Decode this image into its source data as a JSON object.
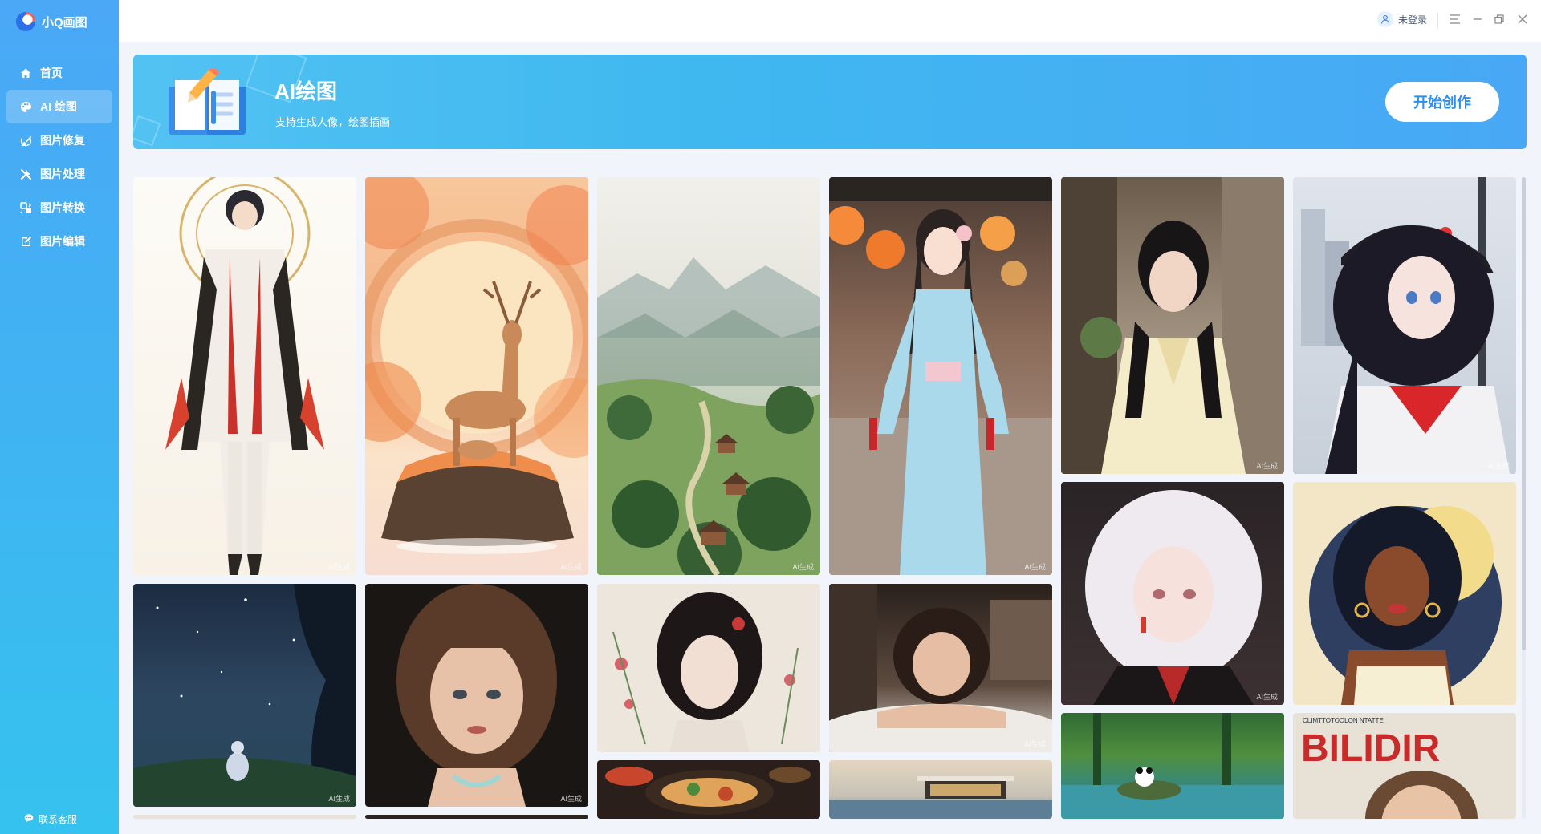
{
  "app": {
    "title": "小Q画图"
  },
  "sidebar": {
    "items": [
      {
        "label": "首页",
        "icon": "home-icon"
      },
      {
        "label": "AI 绘图",
        "icon": "palette-icon"
      },
      {
        "label": "图片修复",
        "icon": "brush-icon"
      },
      {
        "label": "图片处理",
        "icon": "tools-icon"
      },
      {
        "label": "图片转换",
        "icon": "convert-icon"
      },
      {
        "label": "图片编辑",
        "icon": "edit-icon"
      }
    ],
    "active_index": 1,
    "support_label": "联系客服"
  },
  "topbar": {
    "user_label": "未登录"
  },
  "banner": {
    "title": "AI绘图",
    "subtitle": "支持生成人像，绘图插画",
    "cta": "开始创作"
  },
  "gallery": {
    "watermark": "AI生成",
    "cards": [
      {
        "name": "anime-swordsman-card"
      },
      {
        "name": "autumn-deer-card"
      },
      {
        "name": "misty-village-card"
      },
      {
        "name": "qipao-girl-lanterns-card"
      },
      {
        "name": "hanfu-girl-card"
      },
      {
        "name": "sailor-cap-girl-card"
      },
      {
        "name": "starry-night-card"
      },
      {
        "name": "woman-portrait-card"
      },
      {
        "name": "silver-hair-girl-card"
      },
      {
        "name": "pinup-girl-card"
      },
      {
        "name": "classical-chinese-girl-card"
      },
      {
        "name": "woman-on-bed-card"
      },
      {
        "name": "panda-forest-card"
      },
      {
        "name": "food-platter-card"
      },
      {
        "name": "modern-villa-card"
      },
      {
        "name": "magazine-cover-card"
      }
    ],
    "magazine_header": "CLIMTTOTOOLON NTATTE",
    "magazine_title": "BILIDIR"
  }
}
